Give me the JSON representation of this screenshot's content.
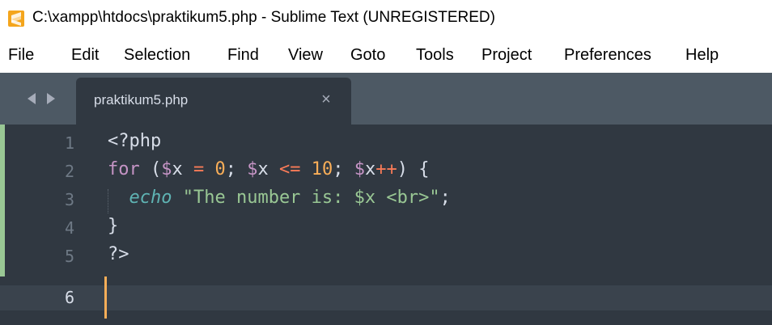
{
  "window": {
    "title": "C:\\xampp\\htdocs\\praktikum5.php - Sublime Text (UNREGISTERED)"
  },
  "menu": {
    "items": [
      "File",
      "Edit",
      "Selection",
      "Find",
      "View",
      "Goto",
      "Tools",
      "Project",
      "Preferences",
      "Help"
    ]
  },
  "tabs": [
    {
      "label": "praktikum5.php",
      "close": "×"
    }
  ],
  "editor": {
    "line_numbers": [
      "1",
      "2",
      "3",
      "4",
      "5",
      "6"
    ],
    "current_line": "6",
    "lines": [
      [
        {
          "t": "<?php",
          "c": "punct"
        }
      ],
      [
        {
          "t": "for",
          "c": "kw"
        },
        {
          "t": " (",
          "c": "punct"
        },
        {
          "t": "$",
          "c": "var"
        },
        {
          "t": "x",
          "c": "punct"
        },
        {
          "t": " = ",
          "c": "op"
        },
        {
          "t": "0",
          "c": "num"
        },
        {
          "t": "; ",
          "c": "punct"
        },
        {
          "t": "$",
          "c": "var"
        },
        {
          "t": "x",
          "c": "punct"
        },
        {
          "t": " <= ",
          "c": "op"
        },
        {
          "t": "10",
          "c": "num"
        },
        {
          "t": "; ",
          "c": "punct"
        },
        {
          "t": "$",
          "c": "var"
        },
        {
          "t": "x",
          "c": "punct"
        },
        {
          "t": "++",
          "c": "op"
        },
        {
          "t": ") {",
          "c": "punct"
        }
      ],
      [
        {
          "t": "  ",
          "c": "punct"
        },
        {
          "t": "echo",
          "c": "echo"
        },
        {
          "t": " ",
          "c": "punct"
        },
        {
          "t": "\"The number is: $x <br>\"",
          "c": "str"
        },
        {
          "t": ";",
          "c": "punct"
        }
      ],
      [
        {
          "t": "}",
          "c": "punct"
        }
      ],
      [
        {
          "t": "?>",
          "c": "punct"
        }
      ],
      []
    ]
  },
  "colors": {
    "editor_bg": "#303841",
    "tabbar_bg": "#4d5964",
    "cursor": "#f9ae58",
    "keyword": "#c594c5",
    "number": "#f9ae58",
    "operator": "#f97b58",
    "string": "#99c794",
    "function": "#5fb4b4"
  }
}
